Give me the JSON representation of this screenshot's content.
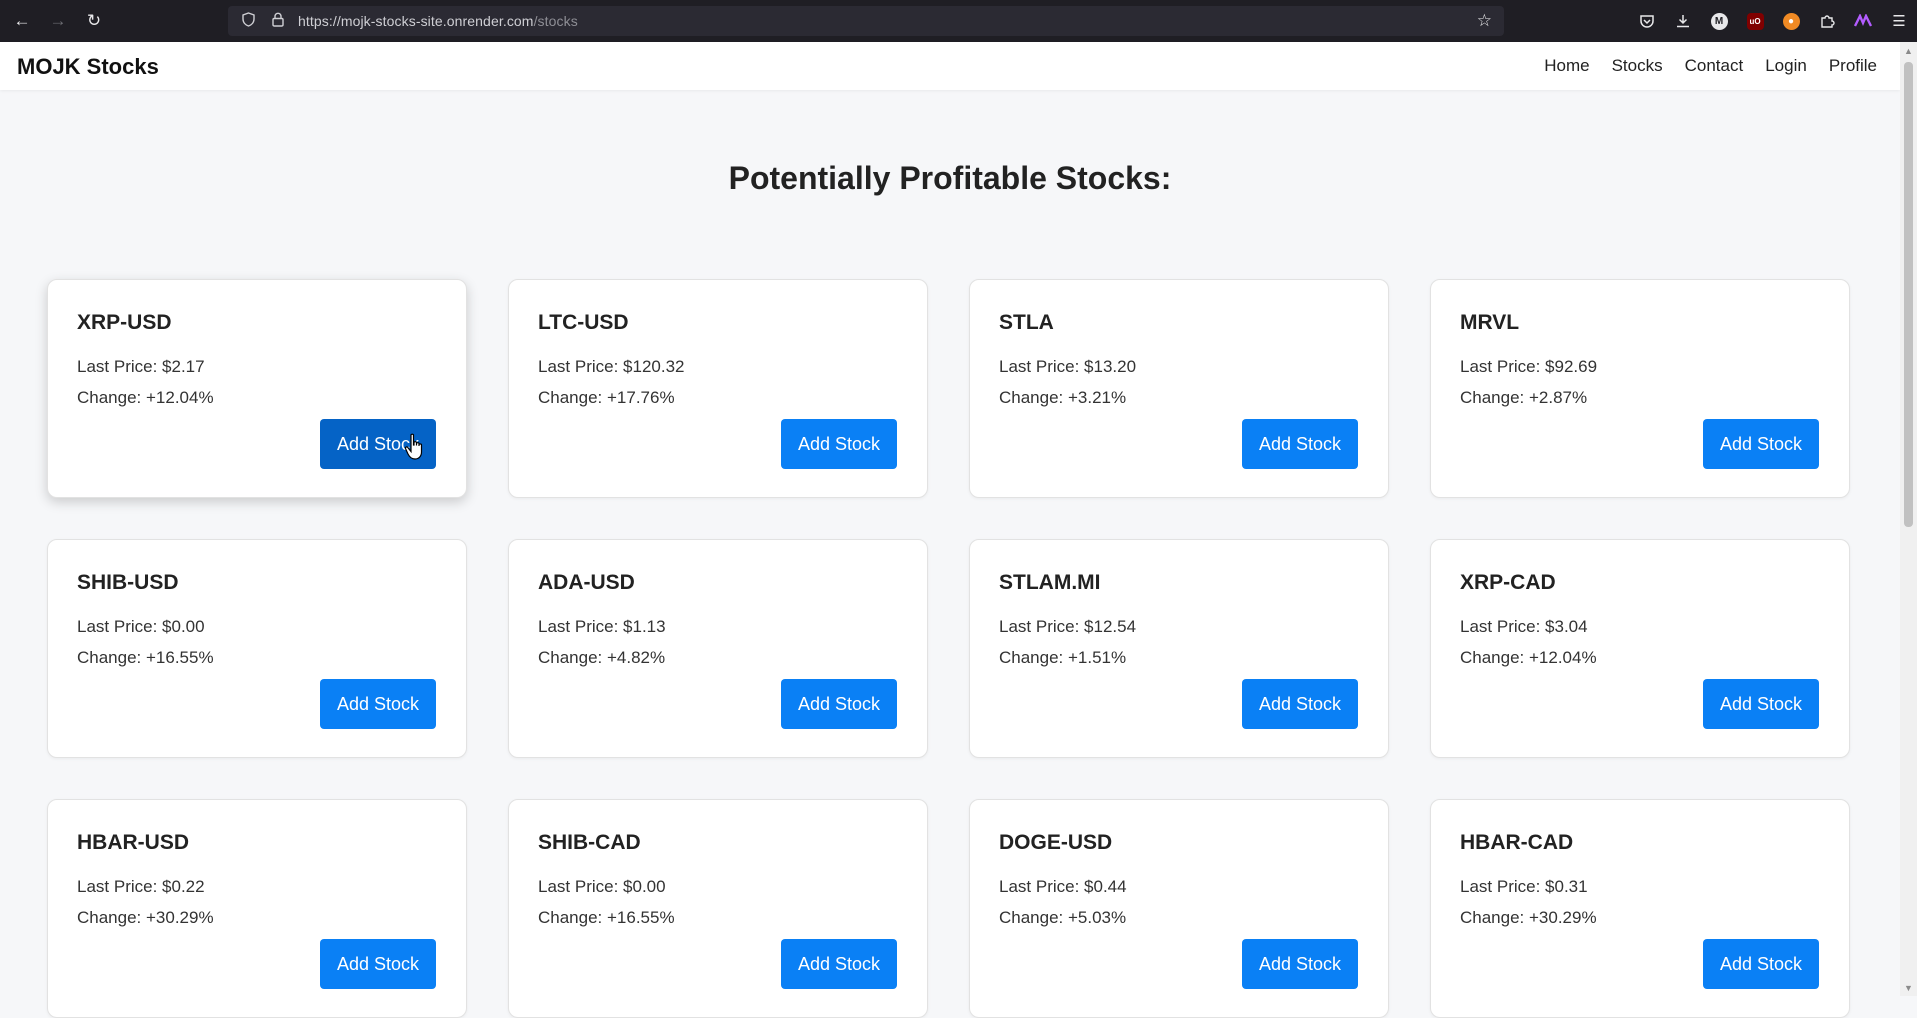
{
  "browser": {
    "url_host": "https://mojk-stocks-site.onrender.com",
    "url_path": "/stocks"
  },
  "site": {
    "brand": "MOJK Stocks",
    "nav": [
      "Home",
      "Stocks",
      "Contact",
      "Login",
      "Profile"
    ]
  },
  "page": {
    "heading": "Potentially Profitable Stocks:"
  },
  "labels": {
    "price_prefix": "Last Price: ",
    "change_prefix": "Change: ",
    "add_button": "Add Stock"
  },
  "stocks": [
    {
      "symbol": "XRP-USD",
      "price": "$2.17",
      "change": "+12.04%"
    },
    {
      "symbol": "LTC-USD",
      "price": "$120.32",
      "change": "+17.76%"
    },
    {
      "symbol": "STLA",
      "price": "$13.20",
      "change": "+3.21%"
    },
    {
      "symbol": "MRVL",
      "price": "$92.69",
      "change": "+2.87%"
    },
    {
      "symbol": "SHIB-USD",
      "price": "$0.00",
      "change": "+16.55%"
    },
    {
      "symbol": "ADA-USD",
      "price": "$1.13",
      "change": "+4.82%"
    },
    {
      "symbol": "STLAM.MI",
      "price": "$12.54",
      "change": "+1.51%"
    },
    {
      "symbol": "XRP-CAD",
      "price": "$3.04",
      "change": "+12.04%"
    },
    {
      "symbol": "HBAR-USD",
      "price": "$0.22",
      "change": "+30.29%"
    },
    {
      "symbol": "SHIB-CAD",
      "price": "$0.00",
      "change": "+16.55%"
    },
    {
      "symbol": "DOGE-USD",
      "price": "$0.44",
      "change": "+5.03%"
    },
    {
      "symbol": "HBAR-CAD",
      "price": "$0.31",
      "change": "+30.29%"
    }
  ],
  "colors": {
    "button": "#0a80f5",
    "button_pressed": "#0563c6",
    "page_bg": "#f6f7f9"
  }
}
